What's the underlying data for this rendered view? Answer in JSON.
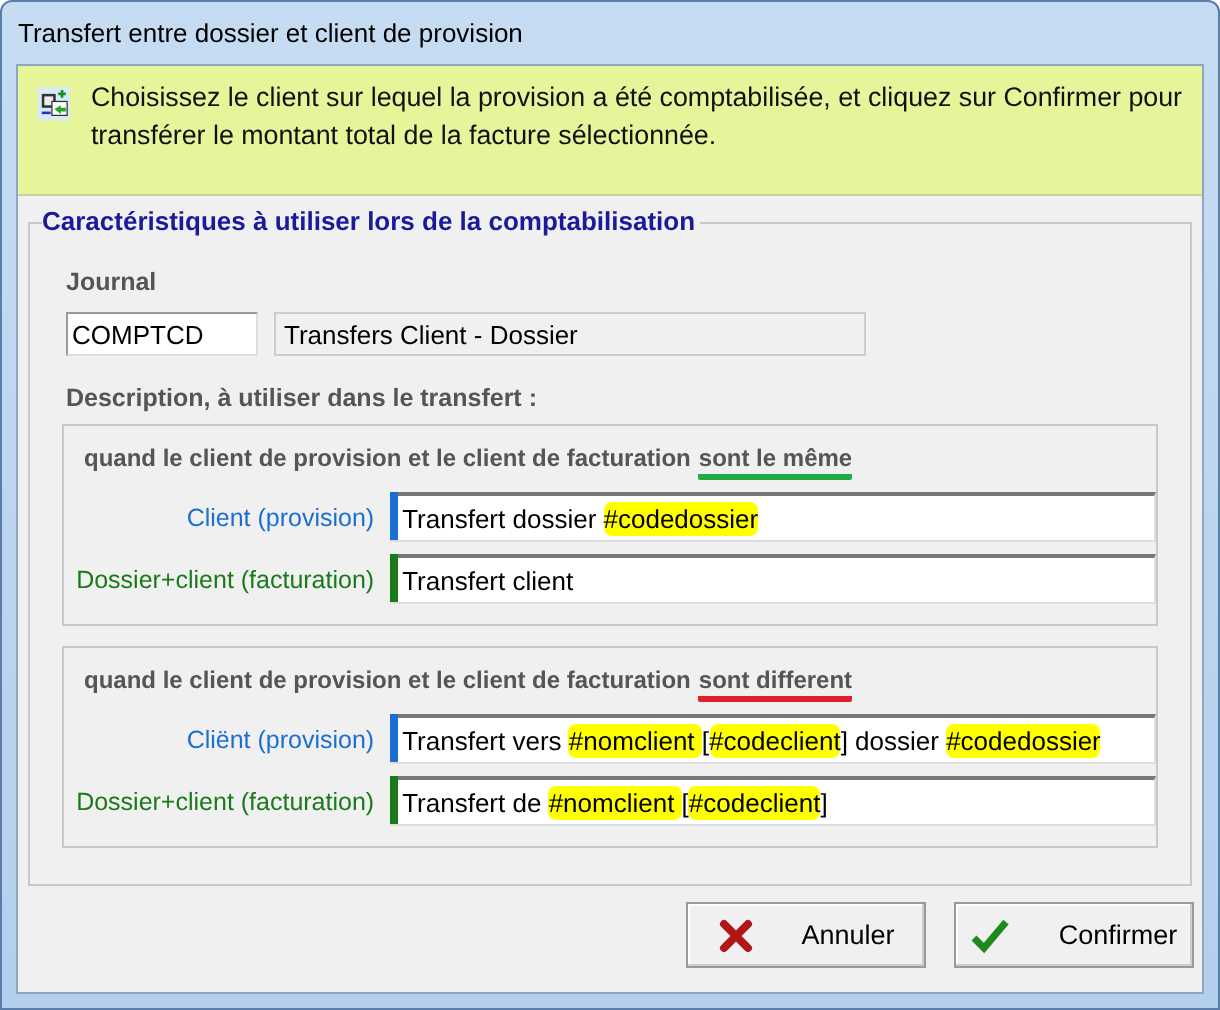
{
  "window": {
    "title": "Transfert entre dossier et client de provision"
  },
  "info": {
    "text": "Choisissez le client sur lequel la provision a été comptabilisée, et cliquez sur Confirmer pour transférer le montant total de la facture sélectionnée."
  },
  "group": {
    "title": "Caractéristiques à utiliser lors de la comptabilisation",
    "journal": {
      "label": "Journal",
      "code": "COMPTCD",
      "name": "Transfers Client - Dossier"
    },
    "description_label": "Description, à utiliser dans le transfert :",
    "sections": [
      {
        "intro": "quand le client de provision et le client de facturation",
        "emphasis": "sont le même",
        "color": "#22aa44",
        "rows": [
          {
            "label": "Client (provision)",
            "color": "#1a6fd0",
            "segments": [
              {
                "text": "Transfert dossier ",
                "highlight": false
              },
              {
                "text": "#codedossier",
                "highlight": true
              }
            ]
          },
          {
            "label": "Dossier+client (facturation)",
            "color": "#1a7a1a",
            "segments": [
              {
                "text": "Transfert client",
                "highlight": false
              }
            ]
          }
        ]
      },
      {
        "intro": "quand le client de provision et le client de facturation",
        "emphasis": "sont different",
        "color": "#e0202a",
        "rows": [
          {
            "label": "Cliënt (provision)",
            "color": "#1a6fd0",
            "segments": [
              {
                "text": "Transfert vers ",
                "highlight": false
              },
              {
                "text": "#nomclient ",
                "highlight": true
              },
              {
                "text": "[",
                "highlight": false
              },
              {
                "text": "#codeclient",
                "highlight": true
              },
              {
                "text": "] dossier ",
                "highlight": false
              },
              {
                "text": "#codedossier",
                "highlight": true
              }
            ]
          },
          {
            "label": "Dossier+client (facturation)",
            "color": "#1a7a1a",
            "segments": [
              {
                "text": "Transfert de ",
                "highlight": false
              },
              {
                "text": "#nomclient ",
                "highlight": true
              },
              {
                "text": "[",
                "highlight": false
              },
              {
                "text": "#codeclient",
                "highlight": true
              },
              {
                "text": "]",
                "highlight": false
              }
            ]
          }
        ]
      }
    ]
  },
  "buttons": [
    {
      "kind": "cancel",
      "label": "Annuler"
    },
    {
      "kind": "confirm",
      "label": "Confirmer"
    }
  ]
}
